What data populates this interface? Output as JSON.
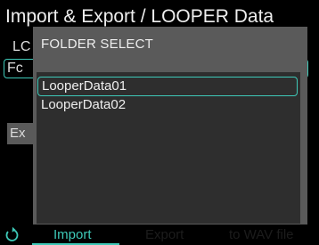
{
  "header": {
    "title": "Import & Export / LOOPER Data"
  },
  "background": {
    "label_fragment": "LC",
    "field_fragment": "Fc",
    "button_fragment": "Ex"
  },
  "dialog": {
    "title": "FOLDER SELECT",
    "items": [
      {
        "label": "LooperData01",
        "selected": true
      },
      {
        "label": "LooperData02",
        "selected": false
      }
    ]
  },
  "bottom_bar": {
    "icon": "undo-icon",
    "accent_color": "#3ec9b8",
    "tabs": [
      {
        "label": "Import",
        "active": true
      },
      {
        "label": "Export",
        "active": false
      },
      {
        "label": "to WAV file",
        "active": false
      }
    ]
  }
}
